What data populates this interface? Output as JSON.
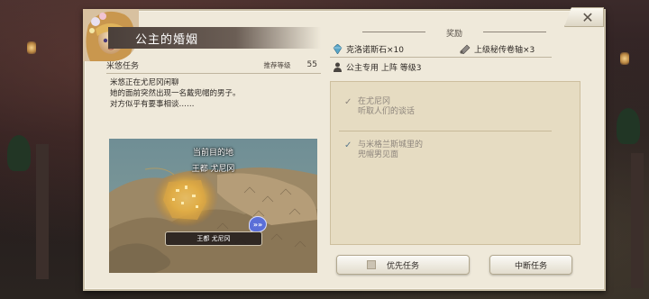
{
  "quest": {
    "title": "公主的婚姻",
    "type_label": "米悠任务",
    "recommended_level_label": "推荐等级",
    "recommended_level": "55",
    "description": [
      "米悠正在尤尼冈闲聊",
      "她的面前突然出现一名戴兜帽的男子。",
      "对方似乎有要事相谈……"
    ]
  },
  "map": {
    "destination_caption": "当前目的地",
    "destination_name": "王都 尤尼冈",
    "pin_label": "王都 尤尼冈",
    "arrow_glyph": "»»"
  },
  "rewards": {
    "header": "奖励",
    "items": [
      {
        "icon": "crystal-icon",
        "label": "克洛诺斯石×10"
      },
      {
        "icon": "scroll-icon",
        "label": "上级秘传卷轴×3"
      },
      {
        "icon": "person-icon",
        "label": "公主专用 上阵 等级3"
      }
    ]
  },
  "objectives": [
    {
      "status": "done",
      "line1": "在尤尼冈",
      "line2": "听取人们的谈话"
    },
    {
      "status": "active",
      "line1": "与米格兰斯城里的",
      "line2": "兜帽男见面"
    }
  ],
  "buttons": {
    "priority": "优先任务",
    "abort": "中断任务",
    "close_glyph": "✕"
  },
  "colors": {
    "panel_bg": "#efe9da",
    "title_bar": "#4a3f3a",
    "objective_box": "#e6dcc2"
  }
}
